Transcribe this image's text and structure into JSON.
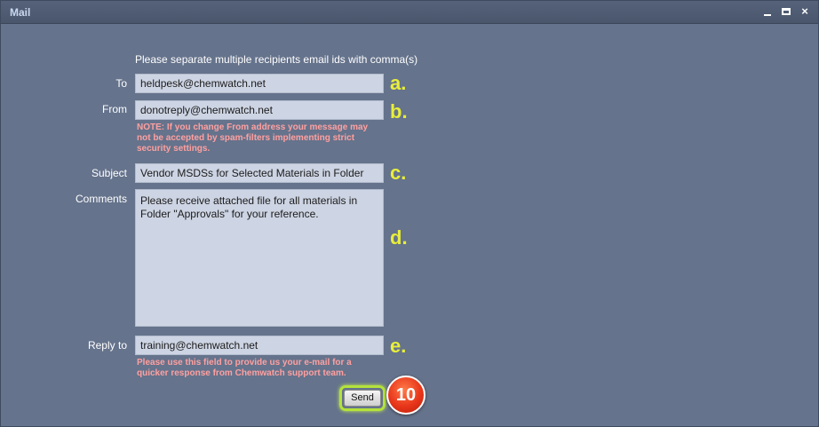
{
  "window": {
    "title": "Mail",
    "controls": {
      "minimize": "minimize-icon",
      "maximize": "maximize-icon",
      "close": "×"
    }
  },
  "form": {
    "hint": "Please separate multiple recipients email ids with comma(s)",
    "to": {
      "label": "To",
      "value": "heldpesk@chemwatch.net",
      "marker": "a."
    },
    "from": {
      "label": "From",
      "value": "donotreply@chemwatch.net",
      "marker": "b.",
      "note_lines": [
        "NOTE: If you change From address your message may",
        "not be accepted by spam-filters implementing strict",
        "security settings."
      ]
    },
    "subject": {
      "label": "Subject",
      "value": "Vendor MSDSs for Selected Materials in Folder",
      "marker": "c."
    },
    "comments": {
      "label": "Comments",
      "value": "Please receive attached file for all materials in\nFolder \"Approvals\" for your reference.",
      "marker": "d."
    },
    "reply_to": {
      "label": "Reply to",
      "value": "training@chemwatch.net",
      "marker": "e.",
      "note_lines": [
        "Please use this field to provide us your e-mail for a",
        "quicker response from Chemwatch support team."
      ]
    },
    "send_label": "Send",
    "step_badge": "10"
  },
  "colors": {
    "background": "#65738c",
    "titlebar": "#4f5b72",
    "field": "#cdd4e3",
    "note": "#ffa0a0",
    "marker": "#e8ee3a",
    "highlight": "#b4e23b",
    "badge": "#e8361a"
  }
}
